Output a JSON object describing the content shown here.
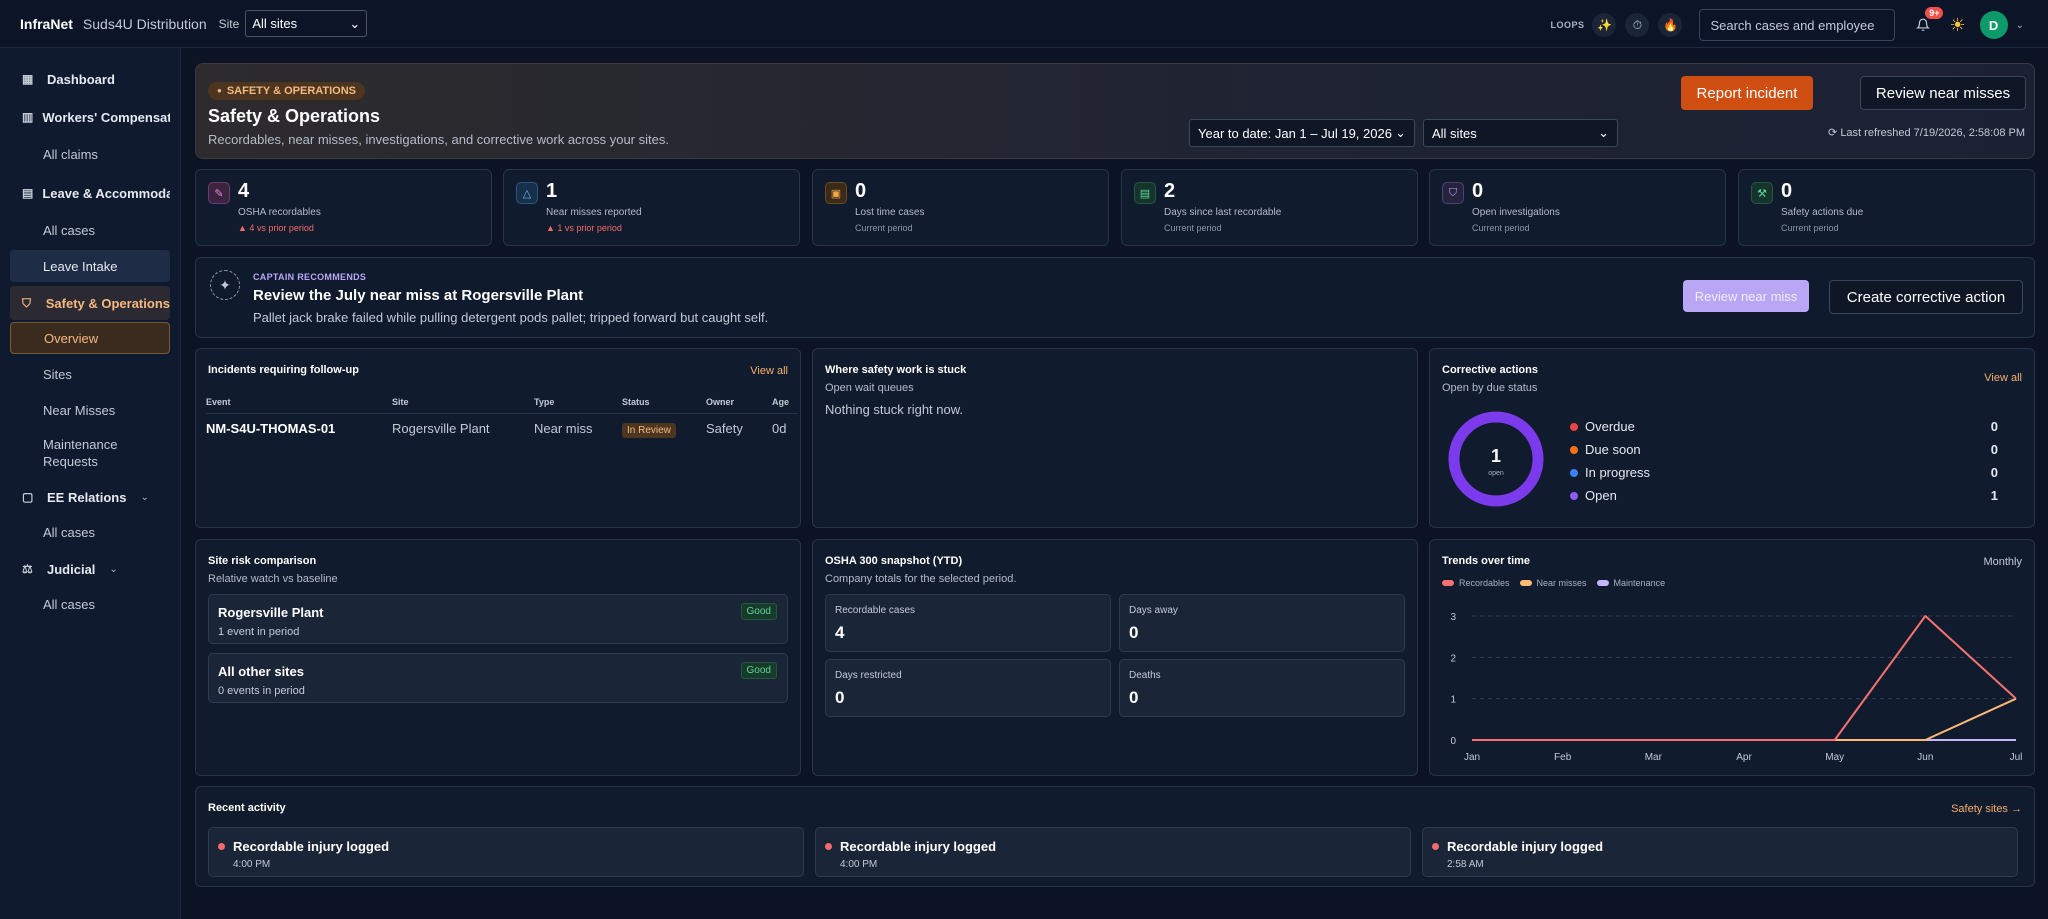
{
  "topbar": {
    "brand": "InfraNet",
    "company": "Suds4U Distribution",
    "site_label": "Site",
    "site_value": "All sites",
    "loops_label": "LOOPS",
    "search_placeholder": "Search cases and employee",
    "notif_badge": "9+",
    "avatar_initial": "D"
  },
  "sidebar": {
    "dashboard": "Dashboard",
    "workers_comp": "Workers' Compensati",
    "all_claims": "All claims",
    "leave": "Leave & Accommodat",
    "leave_all_cases": "All cases",
    "leave_intake": "Leave Intake",
    "safety": "Safety & Operations",
    "overview": "Overview",
    "sites": "Sites",
    "near_misses": "Near Misses",
    "maintenance": "Maintenance Requests",
    "ee_relations": "EE Relations",
    "ee_all_cases": "All cases",
    "judicial": "Judicial",
    "judicial_all_cases": "All cases"
  },
  "hero": {
    "pill": "SAFETY & OPERATIONS",
    "title": "Safety & Operations",
    "subtitle": "Recordables, near misses, investigations, and corrective work across your sites.",
    "report_btn": "Report incident",
    "review_btn": "Review near misses",
    "range": "Year to date: Jan 1 – Jul 19, 2026",
    "site": "All sites",
    "refreshed": "Last refreshed 7/19/2026, 2:58:08 PM"
  },
  "kpis": [
    {
      "value": "4",
      "label": "OSHA recordables",
      "delta": "▲ 4 vs prior period"
    },
    {
      "value": "1",
      "label": "Near misses reported",
      "delta": "▲ 1 vs prior period"
    },
    {
      "value": "0",
      "label": "Lost time cases",
      "delta": "Current period"
    },
    {
      "value": "2",
      "label": "Days since last recordable",
      "delta": "Current period"
    },
    {
      "value": "0",
      "label": "Open investigations",
      "delta": "Current period"
    },
    {
      "value": "0",
      "label": "Safety actions due",
      "delta": "Current period"
    }
  ],
  "captain": {
    "tag": "CAPTAIN RECOMMENDS",
    "title": "Review the July near miss at Rogersville Plant",
    "subtitle": "Pallet jack brake failed while pulling detergent pods pallet; tripped forward but caught self.",
    "btn1": "Review near miss",
    "btn2": "Create corrective action"
  },
  "incidents": {
    "title": "Incidents requiring follow-up",
    "link": "View all",
    "headers": [
      "Event",
      "Site",
      "Type",
      "Status",
      "Owner",
      "Age"
    ],
    "rows": [
      {
        "event": "NM-S4U-THOMAS-01",
        "site": "Rogersville Plant",
        "type": "Near miss",
        "status": "In Review",
        "owner": "Safety",
        "age": "0d"
      }
    ]
  },
  "stuck": {
    "title": "Where safety work is stuck",
    "subtitle": "Open wait queues",
    "empty": "Nothing stuck right now."
  },
  "corrective": {
    "title": "Corrective actions",
    "subtitle": "Open by due status",
    "link": "View all",
    "center_value": "1",
    "center_label": "open",
    "items": [
      {
        "label": "Overdue",
        "value": "0",
        "color": "#ef4444"
      },
      {
        "label": "Due soon",
        "value": "0",
        "color": "#f97316"
      },
      {
        "label": "In progress",
        "value": "0",
        "color": "#3b82f6"
      },
      {
        "label": "Open",
        "value": "1",
        "color": "#8b5cf6"
      }
    ]
  },
  "risk": {
    "title": "Site risk comparison",
    "subtitle": "Relative watch vs baseline",
    "items": [
      {
        "name": "Rogersville Plant",
        "sub": "1 event in period",
        "badge": "Good"
      },
      {
        "name": "All other sites",
        "sub": "0 events in period",
        "badge": "Good"
      }
    ]
  },
  "osha": {
    "title": "OSHA 300 snapshot (YTD)",
    "subtitle": "Company totals for the selected period.",
    "cells": [
      {
        "label": "Recordable cases",
        "value": "4"
      },
      {
        "label": "Days away",
        "value": "0"
      },
      {
        "label": "Days restricted",
        "value": "0"
      },
      {
        "label": "Deaths",
        "value": "0"
      }
    ]
  },
  "trends": {
    "title": "Trends over time",
    "period": "Monthly"
  },
  "chart_data": {
    "type": "line",
    "categories": [
      "Jan",
      "Feb",
      "Mar",
      "Apr",
      "May",
      "Jun",
      "Jul"
    ],
    "series": [
      {
        "name": "Recordables",
        "values": [
          0,
          0,
          0,
          0,
          0,
          3,
          1
        ],
        "color": "#f87171"
      },
      {
        "name": "Near misses",
        "values": [
          0,
          0,
          0,
          0,
          0,
          0,
          1
        ],
        "color": "#fdba74"
      },
      {
        "name": "Maintenance",
        "values": [
          0,
          0,
          0,
          0,
          0,
          0,
          0
        ],
        "color": "#c4b5fd"
      }
    ],
    "yticks": [
      0,
      1,
      2,
      3
    ],
    "ylim": [
      0,
      3
    ],
    "grid": true,
    "legend": "top-left"
  },
  "recent": {
    "title": "Recent activity",
    "link": "Safety sites →",
    "items": [
      {
        "title": "Recordable injury logged",
        "time": "4:00 PM"
      },
      {
        "title": "Recordable injury logged",
        "time": "4:00 PM"
      },
      {
        "title": "Recordable injury logged",
        "time": "2:58 AM"
      }
    ]
  }
}
